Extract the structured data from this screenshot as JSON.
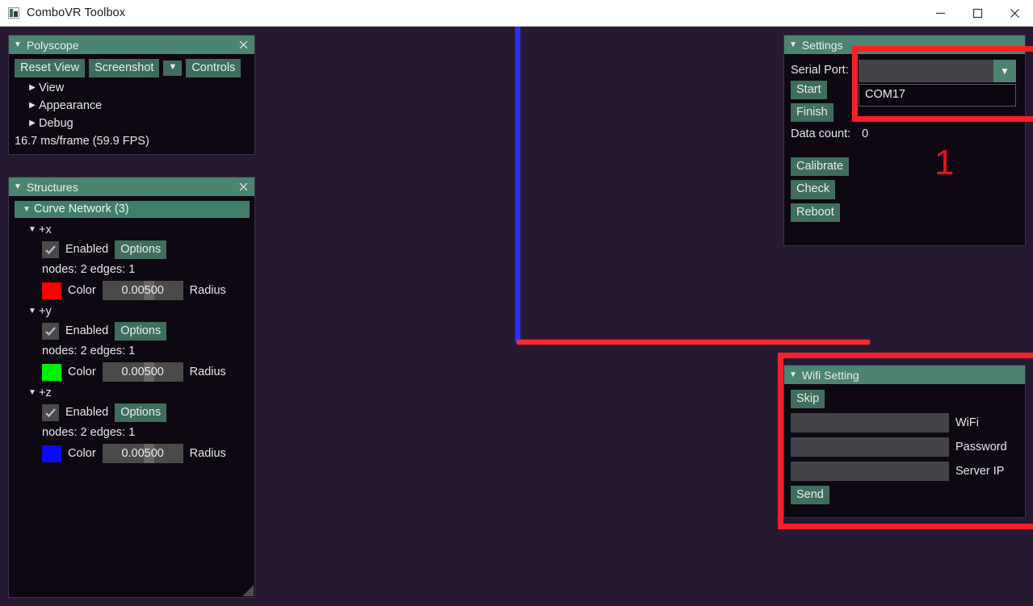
{
  "window": {
    "title": "ComboVR Toolbox",
    "app_icon": "app-icon",
    "minimize_label": "–",
    "maximize_label": "□",
    "close_label": "✕"
  },
  "theme": {
    "viewport_bg": "#251a31",
    "panel_bg": "#0d0811",
    "panel_header": "#4b8471",
    "button_bg": "#3f6e5e",
    "field_bg": "#434348",
    "text": "#e4e7ea",
    "annotation_red": "#fa1f25"
  },
  "viewport": {
    "name": "polyscope-3d-viewport",
    "axes": [
      {
        "name": "x-axis-line",
        "color": "#fd2a2a",
        "orientation": "horizontal"
      },
      {
        "name": "z-axis-line",
        "color": "#2d2dff",
        "orientation": "vertical"
      }
    ]
  },
  "polyscope": {
    "title": "Polyscope",
    "caret": "▼",
    "close": "✕",
    "buttons": [
      {
        "label": "Reset View",
        "name": "reset-view-button"
      },
      {
        "label": "Screenshot",
        "name": "screenshot-button"
      },
      {
        "label": "▼",
        "name": "screenshot-options-caret-button"
      },
      {
        "label": "Controls",
        "name": "controls-button"
      }
    ],
    "tree_items": [
      {
        "label": "View",
        "caret": "▶"
      },
      {
        "label": "Appearance",
        "caret": "▶"
      },
      {
        "label": "Debug",
        "caret": "▶"
      }
    ],
    "fps_text": "16.7 ms/frame (59.9 FPS)"
  },
  "structures": {
    "title": "Structures",
    "caret": "▼",
    "close": "✕",
    "group": {
      "label": "Curve Network (3)",
      "caret": "▼"
    },
    "items": [
      {
        "name": "+x",
        "caret": "▼",
        "enabled_label": "Enabled",
        "enabled_checked": true,
        "options_label": "Options",
        "stats": "nodes: 2  edges: 1",
        "color": "#fe0000",
        "color_label": "Color",
        "radius_value": "0.00500",
        "radius_label": "Radius"
      },
      {
        "name": "+y",
        "caret": "▼",
        "enabled_label": "Enabled",
        "enabled_checked": true,
        "options_label": "Options",
        "stats": "nodes: 2  edges: 1",
        "color": "#00f000",
        "color_label": "Color",
        "radius_value": "0.00500",
        "radius_label": "Radius"
      },
      {
        "name": "+z",
        "caret": "▼",
        "enabled_label": "Enabled",
        "enabled_checked": true,
        "options_label": "Options",
        "stats": "nodes: 2  edges: 1",
        "color": "#0a0afa",
        "color_label": "Color",
        "radius_value": "0.00500",
        "radius_label": "Radius"
      }
    ]
  },
  "settings": {
    "title": "Settings",
    "caret": "▼",
    "serial_port_label": "Serial Port:",
    "serial_port_value": "",
    "serial_port_arrow": "▼",
    "serial_port_options": [
      "COM17"
    ],
    "start_label": "Start",
    "finish_label": "Finish",
    "data_count_label": "Data count:",
    "data_count_value": "0",
    "calibrate_label": "Calibrate",
    "check_label": "Check",
    "reboot_label": "Reboot"
  },
  "wifi": {
    "title": "Wifi Setting",
    "caret": "▼",
    "skip_label": "Skip",
    "fields": [
      {
        "label": "WiFi",
        "value": "",
        "name": "wifi-ssid-field"
      },
      {
        "label": "Password",
        "value": "",
        "name": "wifi-password-field"
      },
      {
        "label": "Server IP",
        "value": "",
        "name": "wifi-server-ip-field"
      }
    ],
    "send_label": "Send"
  },
  "annotations": {
    "box_serial_name": "annotation-box-serial-port",
    "box_wifi_name": "annotation-box-wifi-setting",
    "label_1": "1"
  }
}
